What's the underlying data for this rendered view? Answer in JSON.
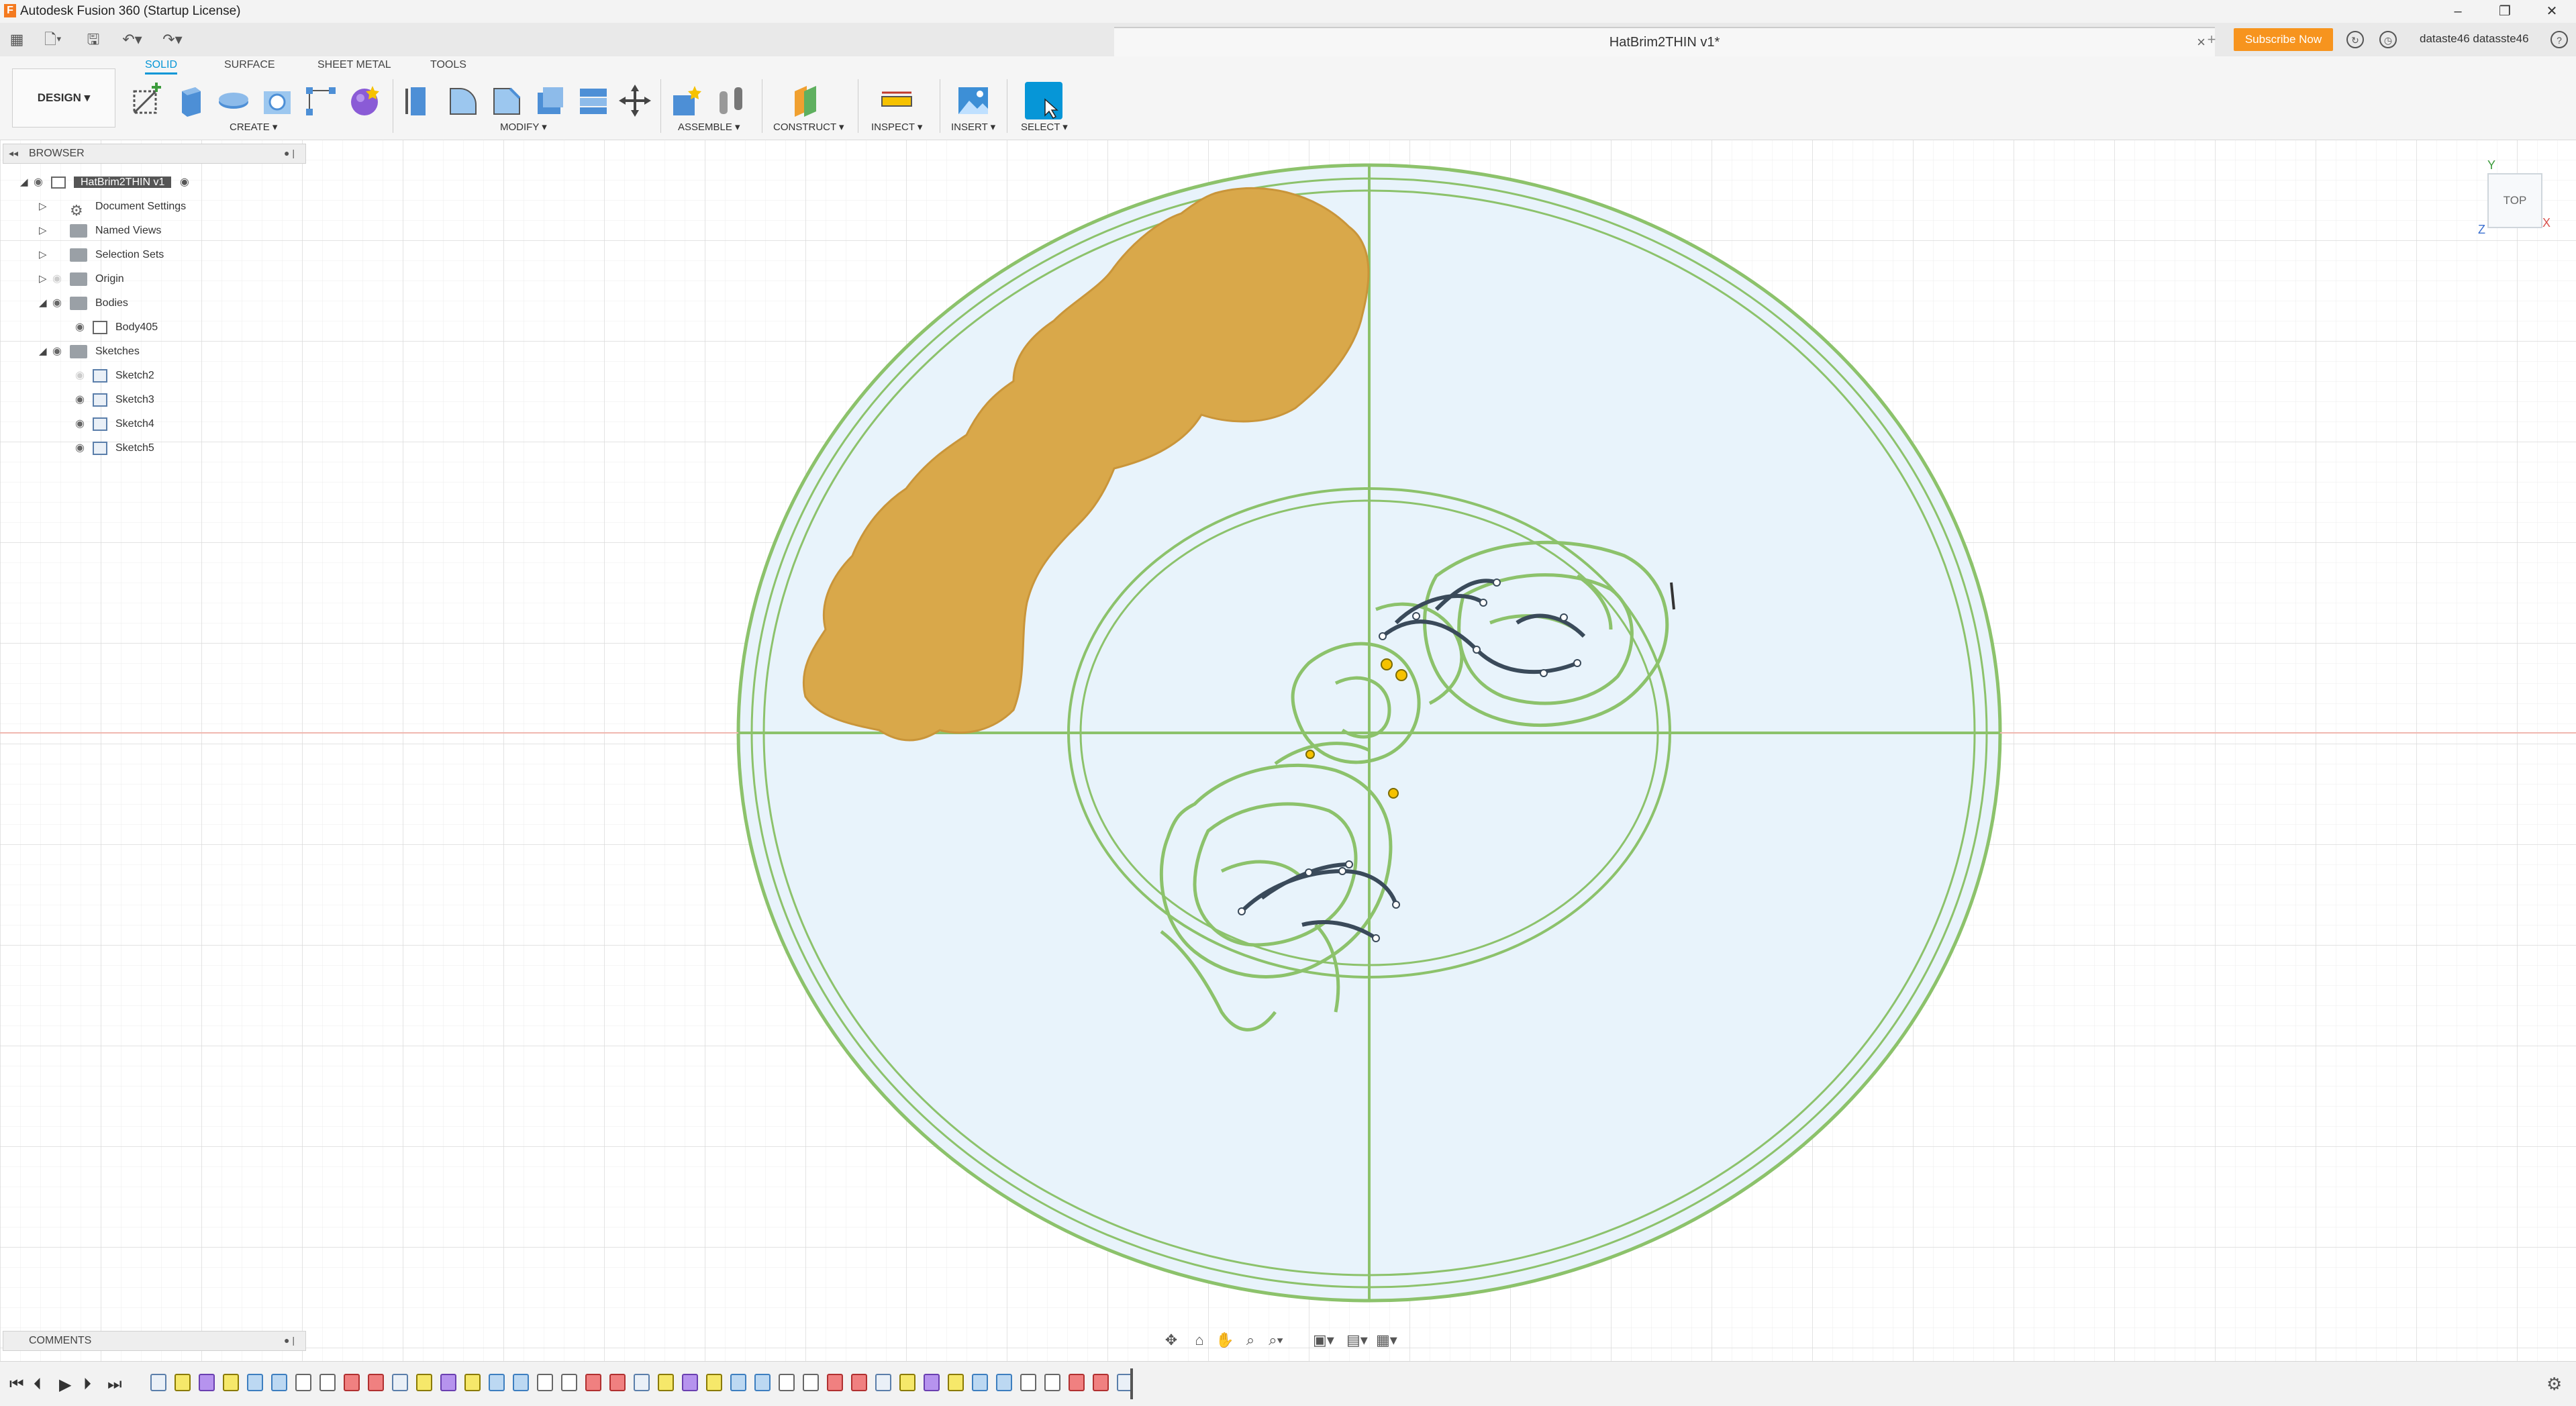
{
  "app": {
    "title": "Autodesk Fusion 360 (Startup License)"
  },
  "document": {
    "title": "HatBrim2THIN v1*",
    "close_icon": "×"
  },
  "account": {
    "subscribe_label": "Subscribe Now",
    "username": "dataste46 datasste46"
  },
  "window_controls": {
    "minimize": "–",
    "restore": "❐",
    "close": "✕"
  },
  "workspace": {
    "label": "DESIGN ▾"
  },
  "ribbon": {
    "tabs": [
      "SOLID",
      "SURFACE",
      "SHEET METAL",
      "TOOLS"
    ],
    "active_tab": "SOLID",
    "groups": [
      "CREATE ▾",
      "MODIFY ▾",
      "ASSEMBLE ▾",
      "CONSTRUCT ▾",
      "INSPECT ▾",
      "INSERT ▾",
      "SELECT ▾"
    ]
  },
  "browser": {
    "title": "BROWSER",
    "root": "HatBrim2THIN v1",
    "items": [
      {
        "label": "Document Settings",
        "icon": "gear-icon"
      },
      {
        "label": "Named Views",
        "icon": "folder-icon"
      },
      {
        "label": "Selection Sets",
        "icon": "folder-icon"
      },
      {
        "label": "Origin",
        "icon": "folder-icon"
      },
      {
        "label": "Bodies",
        "icon": "folder-icon"
      },
      {
        "label": "Body405",
        "icon": "body-icon"
      },
      {
        "label": "Sketches",
        "icon": "folder-icon"
      },
      {
        "label": "Sketch2",
        "icon": "sketch-icon"
      },
      {
        "label": "Sketch3",
        "icon": "sketch-icon"
      },
      {
        "label": "Sketch4",
        "icon": "sketch-icon"
      },
      {
        "label": "Sketch5",
        "icon": "sketch-icon"
      }
    ]
  },
  "comments": {
    "title": "COMMENTS"
  },
  "viewcube": {
    "face": "TOP",
    "axis_y": "Y",
    "axis_x": "X",
    "axis_z": "Z"
  },
  "colors": {
    "accent": "#0696d7",
    "sketch_green": "#8cc26b",
    "body_gold": "#d9a84a",
    "sketch_fill": "#e8f3fb",
    "subscribe": "#f7941e"
  }
}
